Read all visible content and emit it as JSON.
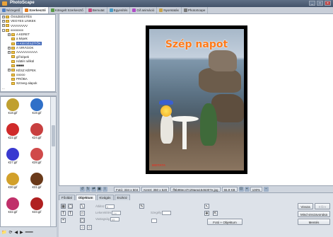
{
  "app": {
    "title": "PhotoScape",
    "window_buttons": [
      "_",
      "□",
      "×"
    ]
  },
  "tabs": [
    {
      "label": "Nézegető",
      "active": false,
      "color": "#4f7fc4"
    },
    {
      "label": "Szerkesztő",
      "active": true,
      "color": "#e07b20"
    },
    {
      "label": "Kötegelt Szerkesztő",
      "active": false,
      "color": "#5a9a48"
    },
    {
      "label": "Bemutat",
      "active": false,
      "color": "#c74b7f"
    },
    {
      "label": "Egyesítés",
      "active": false,
      "color": "#4b9ec7"
    },
    {
      "label": "Gif animáció",
      "active": false,
      "color": "#b04bc7"
    },
    {
      "label": "Nyomtatás",
      "active": false,
      "color": "#c7a34b"
    },
    {
      "label": "PhotoScape",
      "active": false,
      "color": "#7a7a7a"
    }
  ],
  "tree": [
    {
      "label": "ÖSSZEÉSTÉS",
      "level": 1,
      "pm": "+"
    },
    {
      "label": "VEGYES LINKEK",
      "level": 1,
      "pm": "+"
    },
    {
      "label": "VVVVVVVV",
      "level": 1,
      "pm": "+"
    },
    {
      "label": "xxxxxxxx",
      "level": 1,
      "pm": "-"
    },
    {
      "label": "A KERET",
      "level": 2,
      "pm": "+"
    },
    {
      "label": "a képek",
      "level": 2,
      "pm": ""
    },
    {
      "label": "A KIEGÉSZÍTŐK",
      "level": 2,
      "pm": "",
      "selected": true
    },
    {
      "label": "A VIRÁGOK",
      "level": 2,
      "pm": "+"
    },
    {
      "label": "AAAAAAAAAA",
      "level": 2,
      "pm": "+"
    },
    {
      "label": "gif képek",
      "level": 2,
      "pm": ""
    },
    {
      "label": "Háttér nélkül",
      "level": 2,
      "pm": ""
    },
    {
      "label": "■■■■",
      "level": 2,
      "pm": ""
    },
    {
      "label": "KÉSZ KÉPEK",
      "level": 2,
      "pm": "+"
    },
    {
      "label": "ooooo",
      "level": 2,
      "pm": ""
    },
    {
      "label": "PRÓBA",
      "level": 2,
      "pm": ""
    },
    {
      "label": "Szöveg alapok",
      "level": 2,
      "pm": ""
    },
    {
      "label": "...",
      "level": 1,
      "pm": ""
    }
  ],
  "thumbnails": [
    {
      "label": "€18.gif",
      "color": "#c0a030"
    },
    {
      "label": "€19.gif",
      "color": "#3070c8"
    },
    {
      "label": "€22.gif",
      "color": "#d02a2a"
    },
    {
      "label": "€24.gif",
      "color": "#c84040"
    },
    {
      "label": "€27.gif",
      "color": "#3a3ad0"
    },
    {
      "label": "€28.gif",
      "color": "#d04a4a"
    },
    {
      "label": "€30.gif",
      "color": "#d2a02a"
    },
    {
      "label": "€31.gif",
      "color": "#6a3a1a"
    },
    {
      "label": "€32.gif",
      "color": "#c0306a"
    },
    {
      "label": "€33.gif",
      "color": "#b02020"
    }
  ],
  "photo": {
    "title": "Szép napot",
    "watermark": "MISTATA"
  },
  "statusbar": {
    "dimensions": "Fotó: 334 x 504",
    "frame": "Keret: 350 x 520",
    "filename": "ff5b98ec47c29aea1546307e.jpg",
    "filesize": "55.9 KB",
    "zoom": "100%"
  },
  "bottom": {
    "tabs": [
      {
        "label": "Főoldal",
        "active": false
      },
      {
        "label": "Objektum",
        "active": true
      },
      {
        "label": "Kivágás",
        "active": false
      },
      {
        "label": "Eszköz",
        "active": false
      }
    ],
    "opacity_label": "Átlátsz",
    "corners_label": "Lekerekítés",
    "border_label": "Szegély",
    "thickness_label": "Vastagság",
    "opacity_value": "0",
    "radius_value": "24",
    "thickness_value": "45",
    "photo_object_label": "Fotó + Objektum",
    "buttons": {
      "undo": "Vissza",
      "redo": "Előre",
      "undo_all": "Mind visszavonása",
      "save": "Mentés"
    }
  }
}
